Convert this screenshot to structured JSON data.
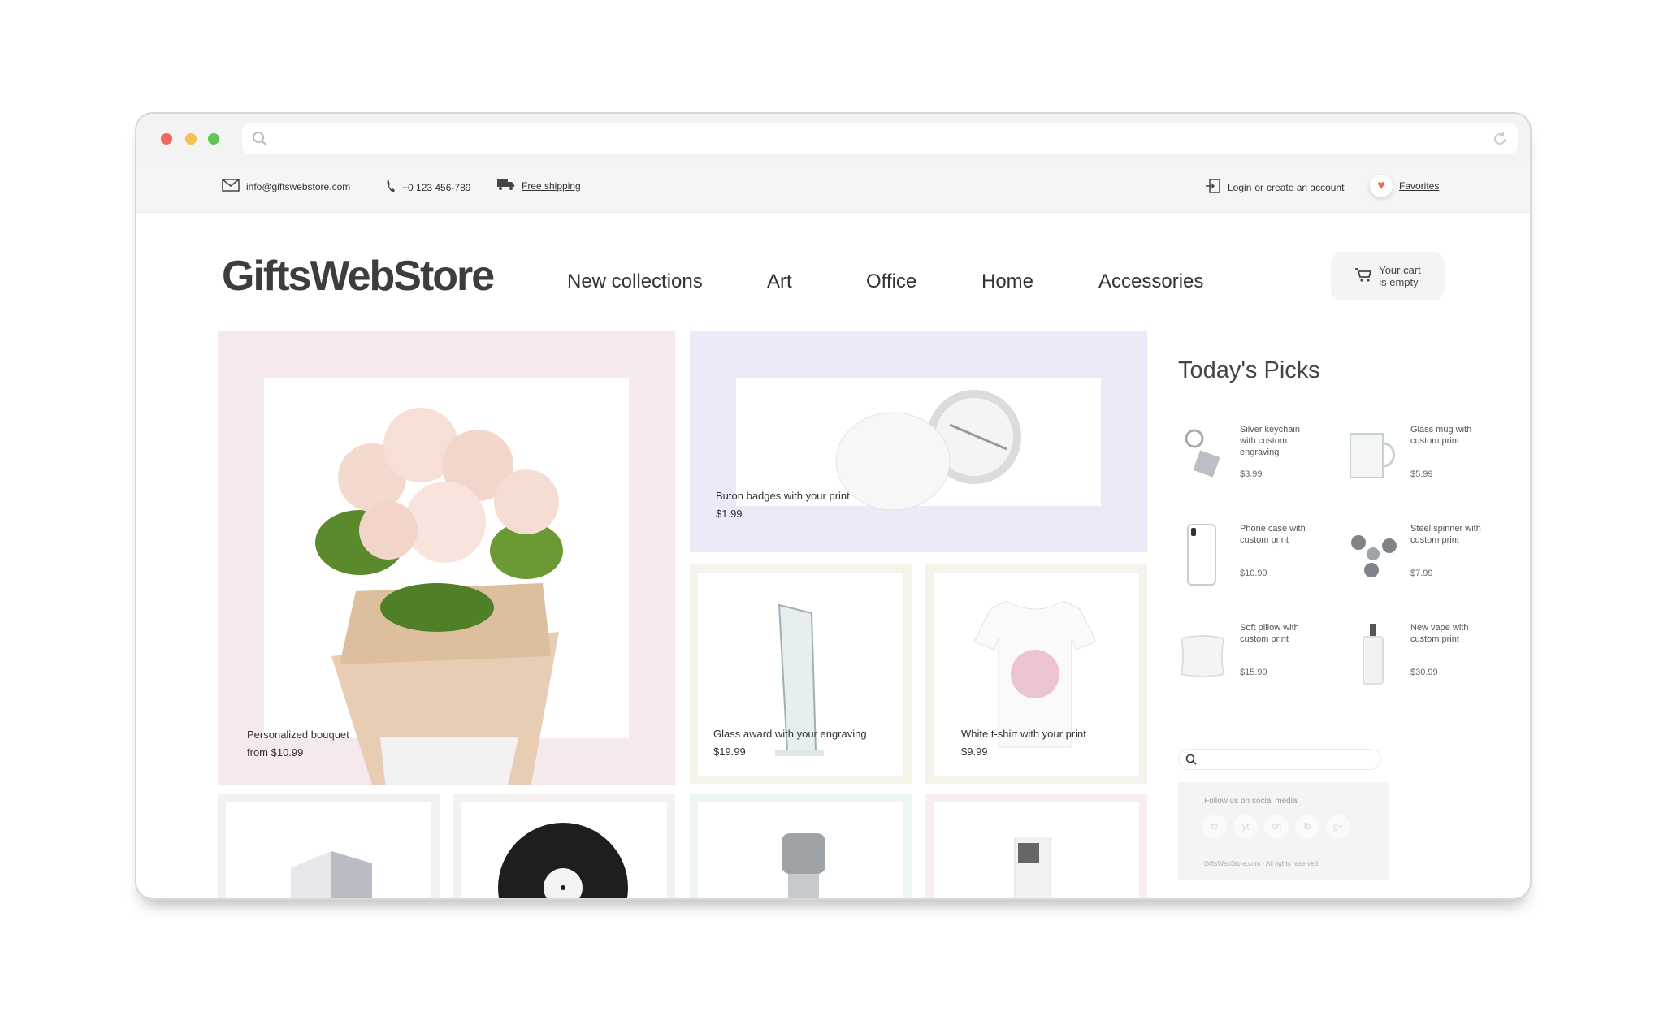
{
  "browser": {
    "url": ""
  },
  "topbar": {
    "email": "info@giftswebstore.com",
    "phone": "+0 123 456-789",
    "shipping": "Free shipping",
    "login": "Login",
    "or": "or",
    "create_account": "create an account",
    "favorites": "Favorites"
  },
  "header": {
    "logo": "GiftsWebStore",
    "nav": [
      "New collections",
      "Art",
      "Office",
      "Home",
      "Accessories"
    ],
    "cart_line1": "Your cart",
    "cart_line2": "is empty"
  },
  "tiles": [
    {
      "title": "Personalized bouquet",
      "price": "from $10.99"
    },
    {
      "title": "Buton badges with your print",
      "price": "$1.99"
    },
    {
      "title": "Glass award with your engraving",
      "price": "$19.99"
    },
    {
      "title": "White t-shirt with your print",
      "price": "$9.99"
    }
  ],
  "picks": {
    "title": "Today's Picks",
    "items": [
      {
        "name": "Silver keychain with custom engraving",
        "price": "$3.99",
        "icon": "keychain-icon"
      },
      {
        "name": "Glass mug with custom print",
        "price": "$5.99",
        "icon": "mug-icon"
      },
      {
        "name": "Phone case with custom print",
        "price": "$10.99",
        "icon": "phone-case-icon"
      },
      {
        "name": "Steel spinner with custom print",
        "price": "$7.99",
        "icon": "spinner-icon"
      },
      {
        "name": "Soft pillow with custom print",
        "price": "$15.99",
        "icon": "pillow-icon"
      },
      {
        "name": "New vape with custom print",
        "price": "$30.99",
        "icon": "vape-icon"
      }
    ]
  },
  "sidebar": {
    "search_placeholder": "",
    "follow": "Follow us on social media",
    "socials": [
      "tv",
      "yt",
      "on",
      "lb",
      "g+"
    ],
    "copyright": "GiftsWebStore.com - All rights reserved"
  },
  "colors": {
    "pink_tile": "#f6e9ee",
    "lavender_tile": "#eceaf8",
    "cream_tile": "#f6f4ea",
    "accent_heart": "#f26a3f"
  }
}
